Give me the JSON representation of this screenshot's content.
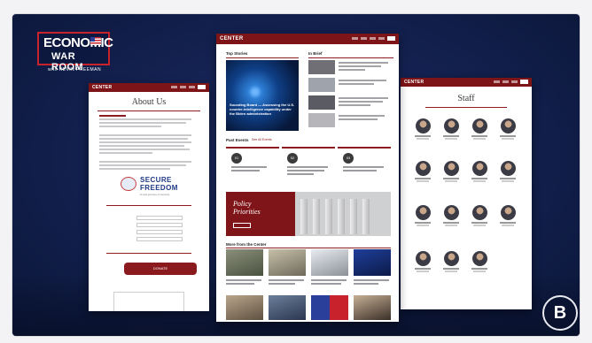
{
  "show_logo": {
    "line1": "ECONOMIC",
    "line2": "WAR ROOM",
    "subtitle": "with KEVIN FREEMAN",
    "flag_icon": "us-flag-icon"
  },
  "watermark": {
    "text": "B",
    "icon": "bannon-b-logo"
  },
  "left_page": {
    "nav_brand": "CENTER",
    "title": "About Us",
    "partner_logo": {
      "line1": "SECURE",
      "line2": "FREEDOM",
      "tagline": "A new journey of security"
    },
    "donate_label": "DONATE"
  },
  "center_page": {
    "nav_brand": "CENTER",
    "sections": {
      "top_stories": "Top Stories",
      "in_brief": "In Brief",
      "past_events": "Past Events",
      "past_events_link": "See All Events",
      "more": "More from the Center"
    },
    "feature_caption": "Sounding Board — Assessing the U.S. counter-intelligence capability under the Biden administration",
    "events": [
      {
        "num": "01"
      },
      {
        "num": "02"
      },
      {
        "num": "03"
      }
    ],
    "policy_banner": {
      "line1": "Policy",
      "line2": "Priorities"
    },
    "colors": {
      "brand_red": "#7d1417",
      "navy": "#142252"
    }
  },
  "right_page": {
    "nav_brand": "CENTER",
    "title": "Staff",
    "staff_count": 16
  }
}
